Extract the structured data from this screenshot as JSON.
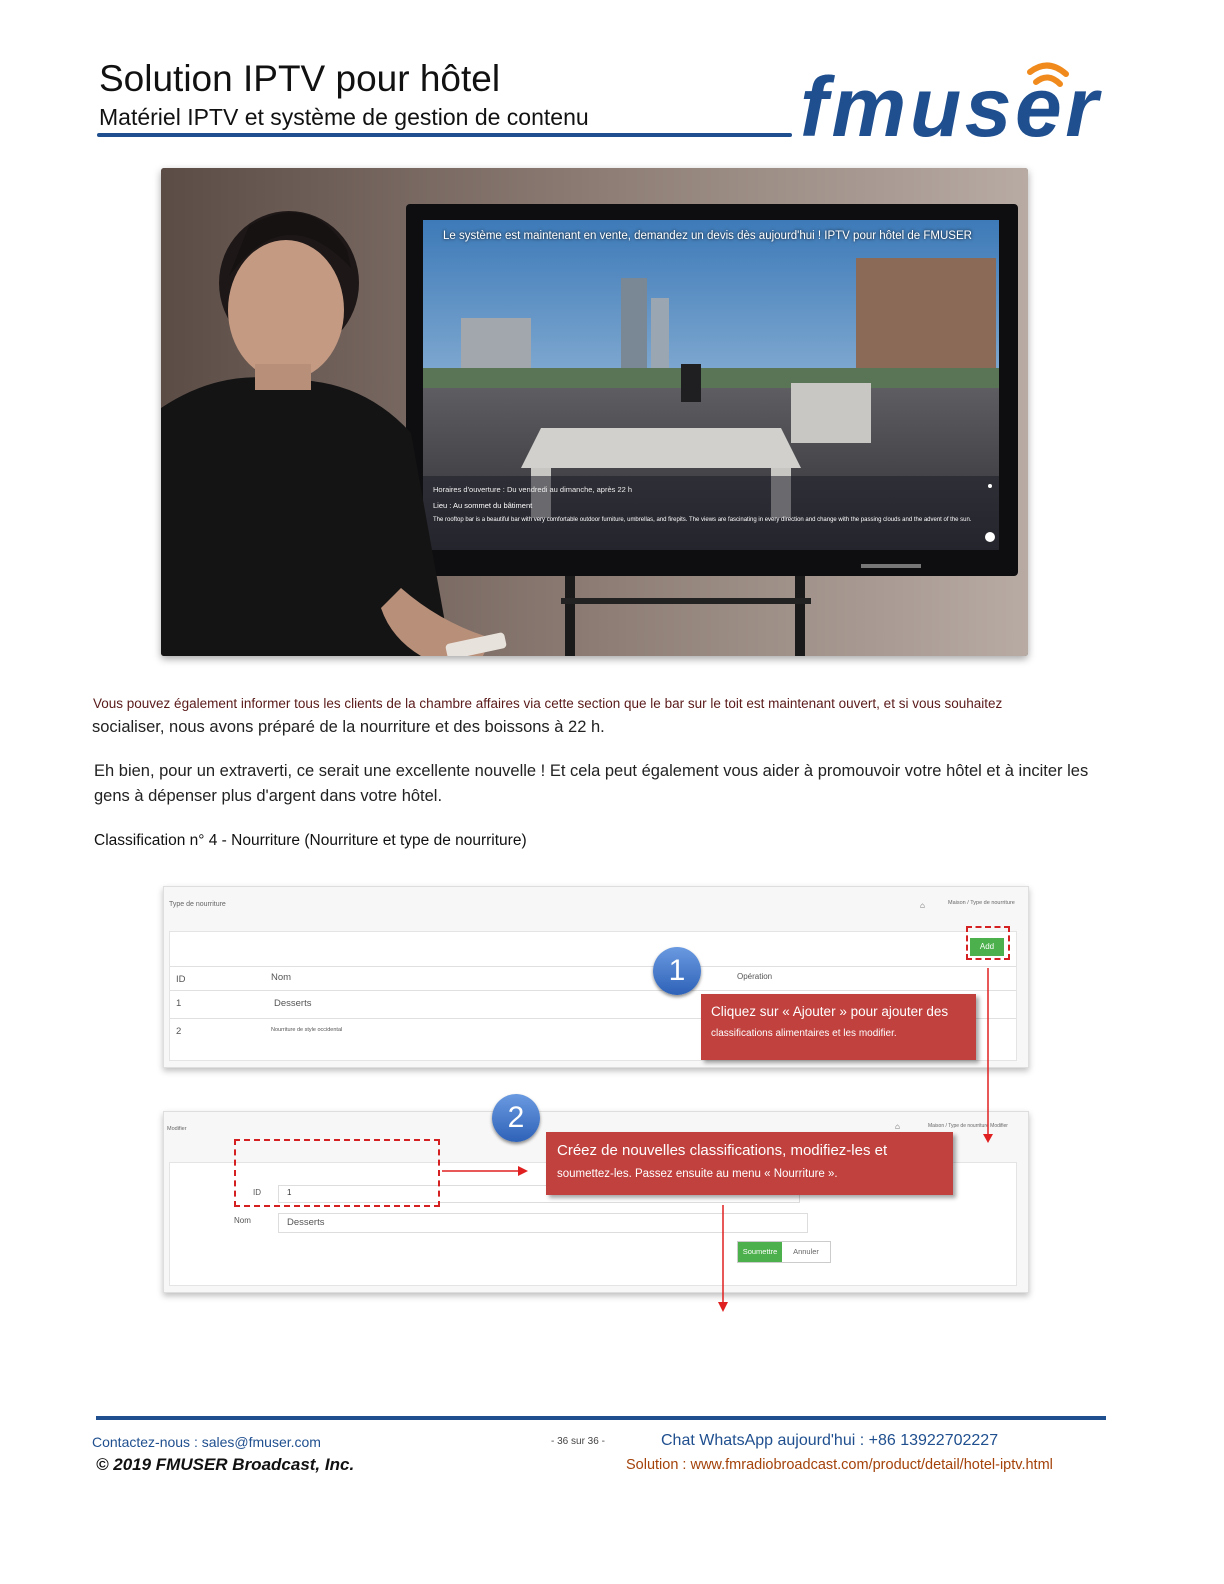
{
  "header": {
    "title": "Solution IPTV pour hôtel",
    "subtitle": "Matériel IPTV et système de gestion de contenu",
    "logo_text": "fmuser",
    "brand_color": "#1f4f8f",
    "accent_color": "#f08a1c"
  },
  "photo": {
    "tv_banner": "Le système est maintenant en vente, demandez un devis dès aujourd'hui ! IPTV pour hôtel de FMUSER",
    "tv_hours": "Horaires d'ouverture : Du vendredi au dimanche, après 22 h",
    "tv_location": "Lieu : Au sommet du bâtiment",
    "tv_description": "The rooftop bar is a beautiful bar with very comfortable outdoor furniture, umbrellas, and firepits. The views are fascinating in every direction and change with the passing clouds and the advent of the sun."
  },
  "body": {
    "p1_line1": "Vous pouvez également informer tous les clients de la chambre affaires via cette section que le bar sur le toit est maintenant ouvert, et si vous souhaitez",
    "p1_line2": "socialiser, nous avons préparé de la nourriture et des boissons à 22 h.",
    "p2": "Eh bien, pour un extraverti, ce serait une excellente nouvelle ! Et cela peut également vous aider à promouvoir votre hôtel et à inciter les gens à dépenser plus d'argent dans votre hôtel.",
    "p3": "Classification n° 4 - Nourriture (Nourriture et type de nourriture)"
  },
  "screenshot1": {
    "page_title": "Type de nourriture",
    "breadcrumb": "Maison / Type de nourriture",
    "add_label": "Add",
    "columns": [
      "ID",
      "Nom",
      "Opération"
    ],
    "rows": [
      {
        "id": "1",
        "name": "Desserts"
      },
      {
        "id": "2",
        "name": "Nourriture de style occidental"
      }
    ],
    "step_number": "1",
    "callout_line1": "Cliquez sur « Ajouter » pour ajouter des",
    "callout_line2": "classifications alimentaires et les modifier."
  },
  "screenshot2": {
    "page_title": "Modifier",
    "breadcrumb": "Maison / Type de nourriture Modifier",
    "id_label": "ID",
    "id_value": "1",
    "name_label": "Nom",
    "name_value": "Desserts",
    "submit_label": "Soumettre",
    "cancel_label": "Annuler",
    "step_number": "2",
    "callout_line1": "Créez de nouvelles classifications, modifiez-les et",
    "callout_line2": "soumettez-les. Passez ensuite au menu « Nourriture »."
  },
  "footer": {
    "contact": "Contactez-nous : sales@fmuser.com",
    "page": "- 36 sur 36 -",
    "whatsapp": "Chat WhatsApp aujourd'hui : +86 13922702227",
    "copyright": "© 2019 FMUSER Broadcast, Inc.",
    "solution": "Solution : www.fmradiobroadcast.com/product/detail/hotel-iptv.html"
  }
}
